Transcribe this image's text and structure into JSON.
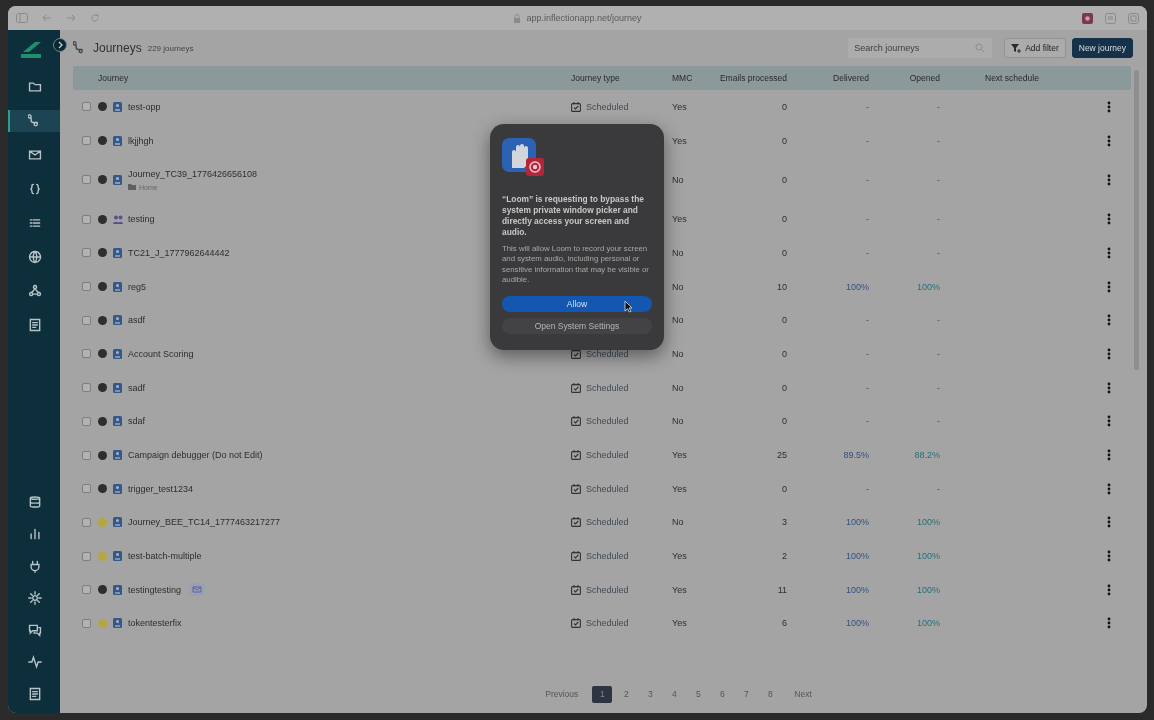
{
  "browser": {
    "url": "app.inflectionapp.net/journey"
  },
  "sidebar": {
    "items": [
      {
        "selected": false
      },
      {
        "selected": true
      },
      {
        "selected": false
      },
      {
        "selected": false
      },
      {
        "selected": false
      },
      {
        "selected": false
      },
      {
        "selected": false
      },
      {
        "selected": false
      }
    ],
    "bottom_items": [
      {
        "selected": false
      },
      {
        "selected": false
      },
      {
        "selected": false
      },
      {
        "selected": false
      },
      {
        "selected": false
      },
      {
        "selected": false
      },
      {
        "selected": false
      }
    ]
  },
  "header": {
    "title": "Journeys",
    "count": "229 journeys",
    "search": {
      "placeholder": "Search journeys"
    },
    "buttons": [
      {
        "label": "Add filter",
        "kind": "filter"
      },
      {
        "label": "New journey",
        "kind": "primary"
      }
    ]
  },
  "table": {
    "columns": [
      "Journey",
      "Journey type",
      "MMC",
      "Emails processed",
      "Delivered",
      "Opened",
      "Next schedule"
    ],
    "rows": [
      {
        "name": "test-opp",
        "checked": false,
        "color": "#2e2e2e",
        "kind": "single",
        "journey_type": "Scheduled",
        "mmc": "Yes",
        "emails": "0",
        "delivered": "-",
        "opened": "-"
      },
      {
        "name": "lkjjhgh",
        "checked": false,
        "color": "#2e2e2e",
        "kind": "single",
        "mmc": "Yes",
        "emails": "0",
        "delivered": "-",
        "opened": "-"
      },
      {
        "name": "Journey_TC39_1776426656108",
        "folder": "Home",
        "checked": false,
        "color": "#2e2e2e",
        "kind": "single",
        "mmc": "No",
        "emails": "0",
        "delivered": "-",
        "opened": "-"
      },
      {
        "name": "testing",
        "checked": false,
        "color": "#2e2e2e",
        "kind": "group",
        "mmc": "Yes",
        "emails": "0",
        "delivered": "-",
        "opened": "-"
      },
      {
        "name": "TC21_J_1777962644442",
        "checked": false,
        "color": "#2e2e2e",
        "kind": "single",
        "mmc": "No",
        "emails": "0",
        "delivered": "-",
        "opened": "-"
      },
      {
        "name": "reg5",
        "checked": false,
        "color": "#2e2e2e",
        "kind": "single",
        "mmc": "No",
        "emails": "10",
        "delivered": "100%",
        "opened": "100%"
      },
      {
        "name": "asdf",
        "checked": false,
        "color": "#2e2e2e",
        "kind": "single",
        "mmc": "No",
        "emails": "0",
        "delivered": "-",
        "opened": "-"
      },
      {
        "name": "Account Scoring",
        "checked": false,
        "color": "#2e2e2e",
        "kind": "single",
        "journey_type": "Scheduled",
        "mmc": "No",
        "emails": "0",
        "delivered": "-",
        "opened": "-"
      },
      {
        "name": "sadf",
        "checked": false,
        "color": "#2e2e2e",
        "kind": "single",
        "journey_type": "Scheduled",
        "mmc": "No",
        "emails": "0",
        "delivered": "-",
        "opened": "-"
      },
      {
        "name": "sdaf",
        "checked": false,
        "color": "#2e2e2e",
        "kind": "single",
        "journey_type": "Scheduled",
        "mmc": "No",
        "emails": "0",
        "delivered": "-",
        "opened": "-"
      },
      {
        "name": "Campaign debugger (Do not Edit)",
        "checked": false,
        "color": "#2e2e2e",
        "kind": "single",
        "journey_type": "Scheduled",
        "mmc": "Yes",
        "emails": "25",
        "delivered": "89.5%",
        "opened": "88.2%"
      },
      {
        "name": "trigger_test1234",
        "checked": false,
        "color": "#2e2e2e",
        "kind": "single",
        "journey_type": "Scheduled",
        "mmc": "Yes",
        "emails": "0",
        "delivered": "-",
        "opened": "-"
      },
      {
        "name": "Journey_BEE_TC14_1777463217277",
        "checked": false,
        "color": "#b5a63f",
        "kind": "single",
        "journey_type": "Scheduled",
        "mmc": "No",
        "emails": "3",
        "delivered": "100%",
        "opened": "100%"
      },
      {
        "name": "test-batch-multiple",
        "checked": false,
        "color": "#b5a63f",
        "kind": "single",
        "journey_type": "Scheduled",
        "mmc": "Yes",
        "emails": "2",
        "delivered": "100%",
        "opened": "100%"
      },
      {
        "name": "testingtesting",
        "email_badge": true,
        "checked": false,
        "color": "#2e2e2e",
        "kind": "single",
        "journey_type": "Scheduled",
        "mmc": "Yes",
        "emails": "11",
        "delivered": "100%",
        "opened": "100%"
      },
      {
        "name": "tokentesterfix",
        "checked": false,
        "color": "#b5a63f",
        "kind": "single",
        "journey_type": "Scheduled",
        "mmc": "Yes",
        "emails": "6",
        "delivered": "100%",
        "opened": "100%"
      }
    ]
  },
  "pagination": {
    "previous": "Previous",
    "pages": [
      {
        "label": "1",
        "selected": true
      },
      {
        "label": "2",
        "selected": false
      },
      {
        "label": "3",
        "selected": false
      },
      {
        "label": "4",
        "selected": false
      },
      {
        "label": "5",
        "selected": false
      },
      {
        "label": "6",
        "selected": false
      },
      {
        "label": "7",
        "selected": false
      },
      {
        "label": "8",
        "selected": false
      }
    ],
    "next": "Next"
  },
  "dialog": {
    "title": "“Loom” is requesting to bypass the system private window picker and directly access your screen and audio.",
    "message": "This will allow Loom to record your screen and system audio, including personal or sensitive information that may be visible or audible.",
    "buttons": [
      {
        "label": "Allow",
        "kind": "primary"
      },
      {
        "label": "Open System Settings",
        "kind": "secondary"
      }
    ]
  }
}
